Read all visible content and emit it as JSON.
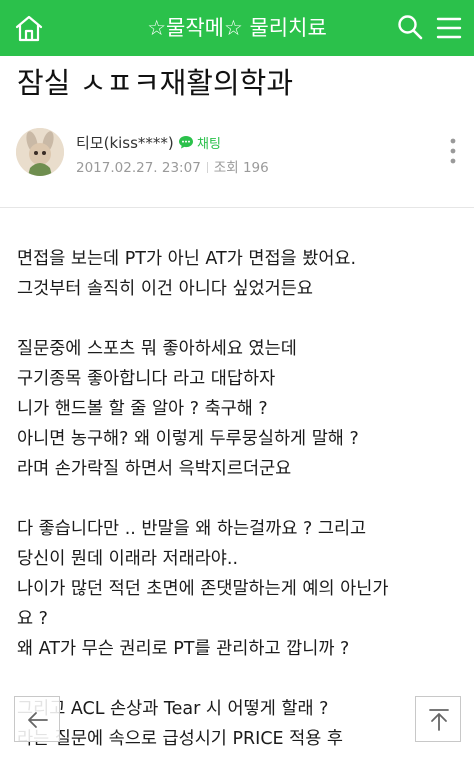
{
  "header": {
    "title": "☆물작메☆ 물리치료",
    "home_icon": "home-icon",
    "search_icon": "search-icon",
    "menu_icon": "hamburger-menu-icon",
    "bg_color": "#2bc14b"
  },
  "post": {
    "title": "잠실 ㅅㅍㅋ재활의학과",
    "author": {
      "name": "티모(kiss****)",
      "chat_label": "채팅",
      "date": "2017.02.27. 23:07",
      "views_label": "조회",
      "views": "196"
    },
    "paragraphs": [
      [
        "면접을 보는데 PT가 아닌 AT가 면접을 봤어요.",
        "그것부터 솔직히 이건 아니다 싶었거든요"
      ],
      [
        "질문중에 스포츠 뭐 좋아하세요 였는데",
        "구기종목 좋아합니다 라고 대답하자",
        "니가 핸드볼 할 줄 알아 ? 축구해 ?",
        "아니면 농구해? 왜 이렇게 두루뭉실하게 말해 ?",
        "라며 손가락질 하면서 윽박지르더군요"
      ],
      [
        "다 좋습니다만 .. 반말을 왜 하는걸까요 ? 그리고",
        "당신이 뭔데 이래라 저래라야..",
        "나이가 많던 적던 초면에 존댓말하는게 예의 아닌가",
        "요 ?",
        "왜 AT가 무슨 권리로 PT를 관리하고 깝니까 ?"
      ],
      [
        "그리고 ACL 손상과 Tear 시 어떻게 할래 ?",
        "라는 질문에 속으로 급성시기 PRICE 적용 후"
      ]
    ]
  },
  "floating": {
    "back_icon": "back-arrow-icon",
    "top_icon": "scroll-top-icon"
  }
}
